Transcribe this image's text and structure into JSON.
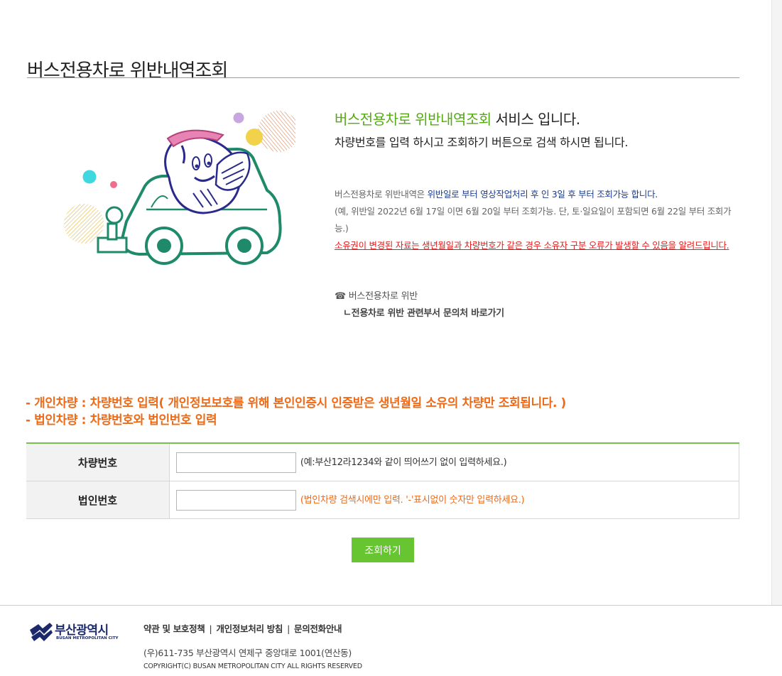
{
  "page": {
    "title": "버스전용차로 위반내역조회"
  },
  "intro": {
    "heading_highlight": "버스전용차로 위반내역조회",
    "heading_rest": " 서비스 입니다.",
    "subheading": "차량번호를 입력 하시고 조회하기 버튼으로 검색 하시면 됩니다."
  },
  "notice": {
    "line1_prefix": "버스전용차로 위반내역은 ",
    "line1_highlight": "위반일로 부터 영상작업처리 후 인 3일 후 부터 조회가능 합니다.",
    "line2": "(예, 위반일 2022년 6월 17일 이면 6월 20일 부터 조회가능. 단, 토·일요일이 포함되면 6월 22일 부터 조회가능.)",
    "warning": "소유권이 변경된 자료는 생년월일과 차량번호가 같은 경우 소유자 구분 오류가 발생할 수 있음을 알려드립니다."
  },
  "contact": {
    "icon": "phone-icon",
    "label": "버스전용차로 위반",
    "link": "ㄴ전용차로 위반 관련부서 문의처 바로가기"
  },
  "guide": {
    "personal": "- 개인차량 : 차량번호 입력( 개인정보보호를 위해 본인인증시 인증받은 생년월일 소유의 차량만 조회됩니다. )",
    "corporate": "- 법인차량 : 차량번호와 법인번호 입력"
  },
  "form": {
    "vehicle_label": "차량번호",
    "vehicle_value": "",
    "vehicle_hint": "(예:부산12라1234와 같이 띄어쓰기 없이 입력하세요.)",
    "corp_label": "법인번호",
    "corp_value": "",
    "corp_hint": "(법인차량 검색시에만 입력. '-'표시없이 숫자만 입력하세요.)",
    "submit_label": "조회하기"
  },
  "footer": {
    "logo_ko": "부산광역시",
    "logo_en": "BUSAN METROPOLITAN CITY",
    "links": [
      "약관 및 보호정책",
      "개인정보처리 방침",
      "문의전화안내"
    ],
    "separator": "|",
    "address": "(우)611-735 부산광역시 연제구 중앙대로 1001(연산동)",
    "copyright": "COPYRIGHT(C) BUSAN METROPOLITAN CITY ALL RIGHTS RESERVED"
  },
  "colors": {
    "accent_green": "#55aa16",
    "button_green": "#66c530",
    "orange": "#ee6a17",
    "blue_text": "#1d3c8f",
    "warning_red": "#e01f1f",
    "mascot_green": "#1f8a6a"
  }
}
